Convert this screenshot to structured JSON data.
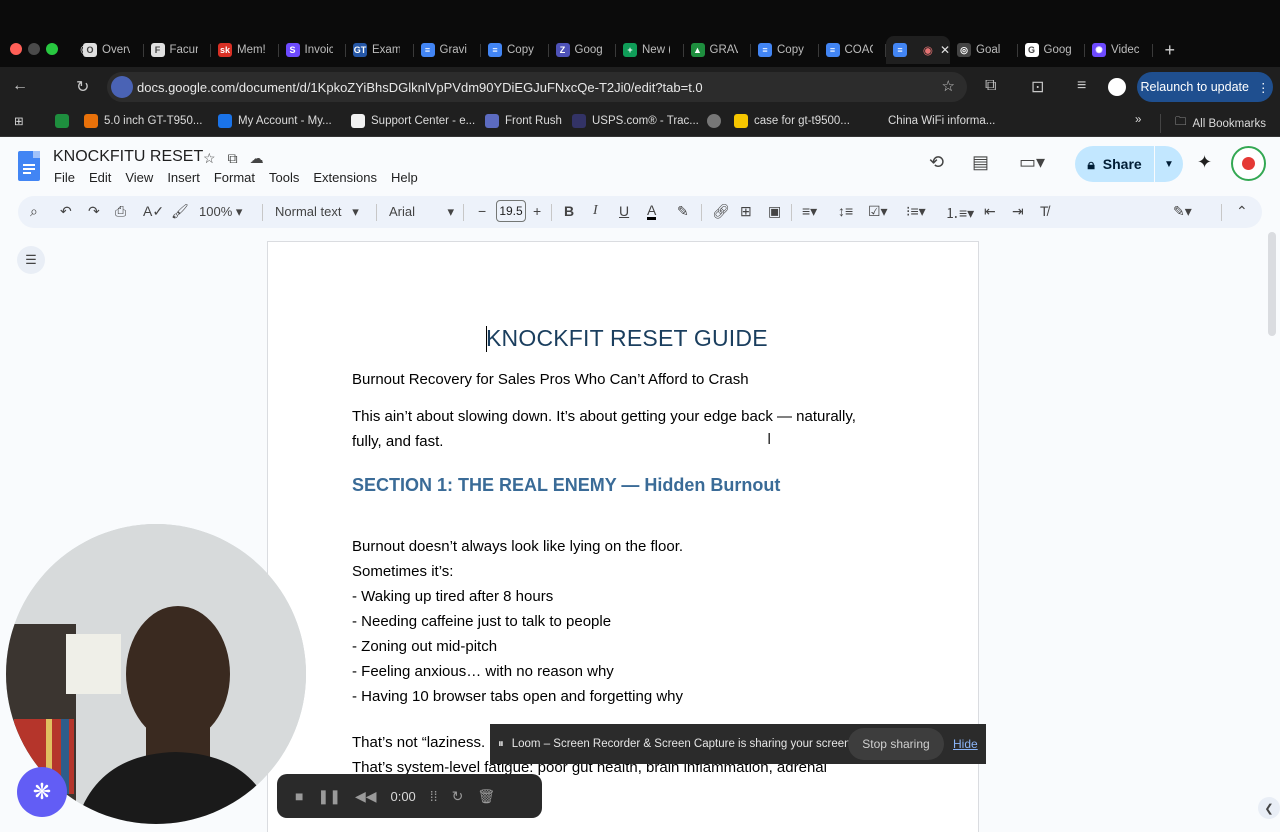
{
  "browser": {
    "tabs": [
      {
        "label": "Overv",
        "icon": "O",
        "color": "#e0e0e0"
      },
      {
        "label": "Facur",
        "icon": "F",
        "color": "#e0e0e0"
      },
      {
        "label": "Mem!",
        "icon": "sk",
        "color": "#d93025"
      },
      {
        "label": "Invoic",
        "icon": "S",
        "color": "#6d4aff"
      },
      {
        "label": "Exam",
        "icon": "GT",
        "color": "#2557a7"
      },
      {
        "label": "Gravi",
        "icon": "≡",
        "color": "#4285f4"
      },
      {
        "label": "Copy",
        "icon": "≡",
        "color": "#4285f4"
      },
      {
        "label": "Goog",
        "icon": "Z",
        "color": "#4e52b8"
      },
      {
        "label": "New (",
        "icon": "+",
        "color": "#0f9d58"
      },
      {
        "label": "GRAV",
        "icon": "▲",
        "color": "#1e8e3e"
      },
      {
        "label": "Copy",
        "icon": "≡",
        "color": "#4285f4"
      },
      {
        "label": "COAC",
        "icon": "≡",
        "color": "#4285f4"
      },
      {
        "label": "",
        "icon": "≡",
        "color": "#4285f4",
        "active": true
      },
      {
        "label": "Goal",
        "icon": "◎",
        "color": "#444444"
      },
      {
        "label": "Goog",
        "icon": "G",
        "color": "#ffffff"
      },
      {
        "label": "Videc",
        "icon": "✺",
        "color": "#6d4aff"
      }
    ],
    "url": "docs.google.com/document/d/1KpkoZYiBhsDGlknlVpPVdm90YDiEGJuFNxcQe-T2Ji0/edit?tab=t.0",
    "relaunch_label": "Relaunch to update",
    "bookmarks": [
      "5.0 inch GT-T950...",
      "My Account - My...",
      "Support Center - e...",
      "Front Rush",
      "USPS.com® - Trac...",
      "case for gt-t9500...",
      "China WiFi informa..."
    ],
    "all_bookmarks": "All Bookmarks"
  },
  "docs": {
    "title": "KNOCKFITU RESET",
    "menu": [
      "File",
      "Edit",
      "View",
      "Insert",
      "Format",
      "Tools",
      "Extensions",
      "Help"
    ],
    "share_label": "Share",
    "zoom": "100%",
    "style": "Normal text",
    "font": "Arial",
    "font_size": "19.5"
  },
  "document": {
    "heading": "KNOCKFIT RESET GUIDE",
    "subtitle": "Burnout Recovery for Sales Pros Who Can’t Afford to Crash",
    "intro_line1": "This ain’t about slowing down. It’s about getting your edge back — naturally,",
    "intro_line2": "fully, and fast.",
    "section1": "SECTION 1: THE REAL ENEMY — Hidden Burnout",
    "list": [
      "Burnout doesn’t always look like lying on the floor.",
      "Sometimes it’s:",
      "- Waking up tired after 8 hours",
      "- Needing caffeine just to talk to people",
      "- Zoning out mid-pitch",
      "- Feeling anxious… with no reason why",
      "- Having 10 browser tabs open and forgetting why"
    ],
    "tail1": "That’s not “laziness.",
    "tail2": "That’s system-level fatigue: poor gut health, brain inflammation, adrenal"
  },
  "loom": {
    "sharing_text": "Loom – Screen Recorder & Screen Capture is sharing your screen.",
    "stop_label": "Stop sharing",
    "hide_label": "Hide",
    "timer": "0:00"
  }
}
